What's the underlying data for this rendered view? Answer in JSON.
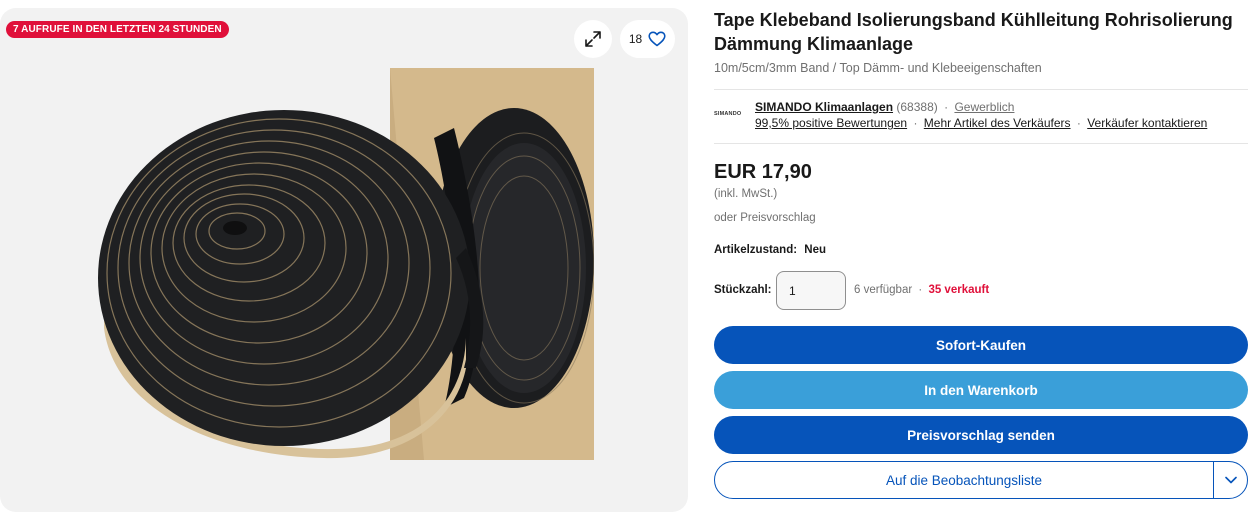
{
  "gallery": {
    "badge": "7 AUFRUFE IN DEN LETZTEN 24 STUNDEN",
    "expand_icon": "expand-arrows-icon",
    "watch_count": "18",
    "watch_icon": "heart-icon"
  },
  "listing": {
    "title": "Tape Klebeband Isolierungsband Kühlleitung Rohrisolierung Dämmung Klimaanlage",
    "subtitle": "10m/5cm/3mm Band / Top Dämm- und Klebeeigenschaften"
  },
  "seller": {
    "logo_text": "SIMANDO",
    "name": "SIMANDO Klimaanlagen",
    "feedback_count": "(68388)",
    "type": "Gewerblich",
    "positive": "99,5% positive Bewertungen",
    "more_items": "Mehr Artikel des Verkäufers",
    "contact": "Verkäufer kontaktieren"
  },
  "price": {
    "amount": "EUR 17,90",
    "vat_note": "(inkl. MwSt.)",
    "offer_note": "oder Preisvorschlag"
  },
  "condition": {
    "label": "Artikelzustand:",
    "value": "Neu"
  },
  "quantity": {
    "label": "Stückzahl:",
    "value": "1",
    "available": "6 verfügbar",
    "sold": "35 verkauft"
  },
  "actions": {
    "buy_now": "Sofort-Kaufen",
    "add_to_cart": "In den Warenkorb",
    "make_offer": "Preisvorschlag senden",
    "watchlist": "Auf die Beobachtungsliste",
    "watchlist_dropdown_icon": "chevron-down-icon"
  },
  "colors": {
    "primary": "#0654ba",
    "secondary": "#3a9fd9",
    "badge": "#e0103a",
    "sold": "#e0103a"
  }
}
